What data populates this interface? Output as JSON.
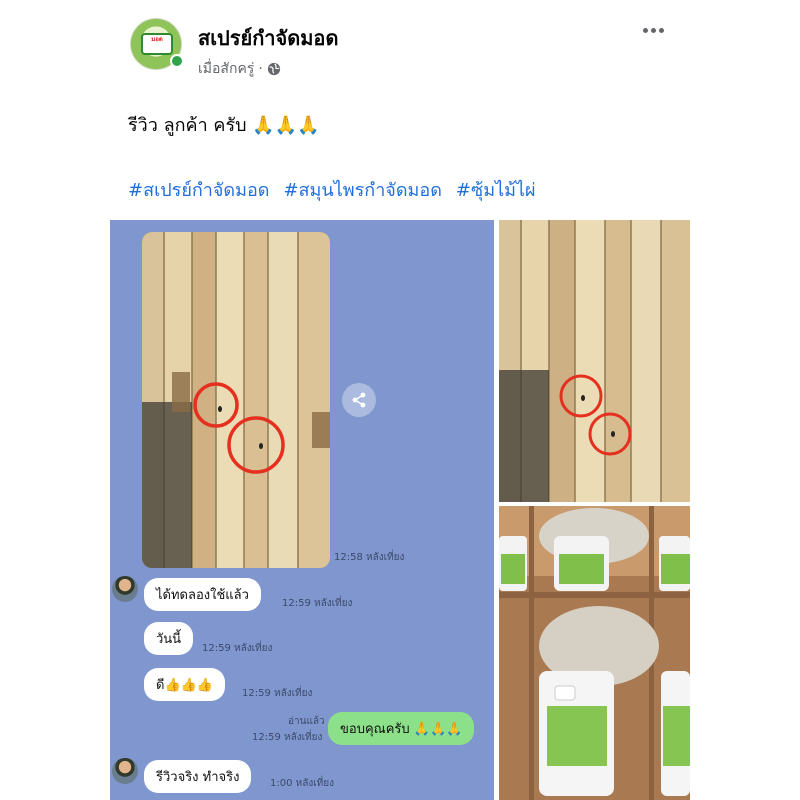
{
  "header": {
    "page_name": "สเปรย์กำจัดมอด",
    "time": "เมื่อสักครู่",
    "separator": "·"
  },
  "post": {
    "caption": "รีวิว ลูกค้า ครับ 🙏🙏🙏",
    "hashtags": [
      "#สเปรย์กำจัดมอด",
      "#สมุนไพรกำจัดมอด",
      "#ซุ้มไม้ไผ่"
    ]
  },
  "chat": {
    "photo_time": "12:58 หลังเที่ยง",
    "messages": [
      {
        "text": "ได้ทดลองใช้แล้ว",
        "time": "12:59 หลังเที่ยง"
      },
      {
        "text": "วันนี้",
        "time": "12:59 หลังเที่ยง"
      },
      {
        "text": "ดี👍👍👍",
        "time": "12:59 หลังเที่ยง"
      },
      {
        "text": "ขอบคุณครับ 🙏🙏🙏",
        "time": "12:59 หลังเที่ยง",
        "read": "อ่านแล้ว"
      },
      {
        "text": "รีวิวจริง ทำจริง",
        "time": "1:00 หลังเที่ยง"
      }
    ]
  },
  "colors": {
    "link": "#216fdb",
    "online": "#31a24c",
    "chat_bg": "#7f97ce",
    "my_bubble": "#8de08a"
  },
  "icons": [
    "globe-icon",
    "more-icon",
    "share-icon"
  ]
}
